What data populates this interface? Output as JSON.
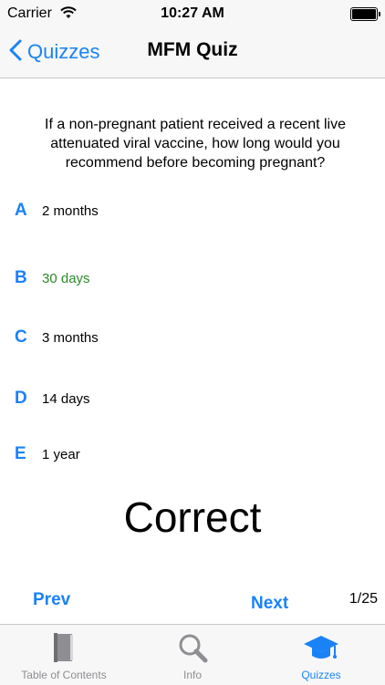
{
  "status_bar": {
    "carrier": "Carrier",
    "time": "10:27 AM"
  },
  "nav": {
    "back_label": "Quizzes",
    "title": "MFM Quiz"
  },
  "question": "If a non-pregnant patient received a recent live attenuated viral vaccine, how long would you recommend before becoming pregnant?",
  "answers": [
    {
      "letter": "A",
      "text": "2 months"
    },
    {
      "letter": "B",
      "text": "30 days",
      "highlight": "#2a8a2a"
    },
    {
      "letter": "C",
      "text": "3 months"
    },
    {
      "letter": "D",
      "text": "14 days"
    },
    {
      "letter": "E",
      "text": "1 year"
    }
  ],
  "result": "Correct",
  "pager": {
    "prev_label": "Prev",
    "next_label": "Next",
    "counter": "1/25"
  },
  "tabs": [
    {
      "label": "Table of Contents",
      "icon": "book-icon"
    },
    {
      "label": "Info",
      "icon": "magnifier-icon"
    },
    {
      "label": "Quizzes",
      "icon": "graduation-cap-icon",
      "active": true
    }
  ],
  "colors": {
    "accent": "#1a82f7",
    "correct": "#2a8a2a",
    "bar_bg": "#f7f7f7",
    "inactive": "#8e8e93"
  }
}
